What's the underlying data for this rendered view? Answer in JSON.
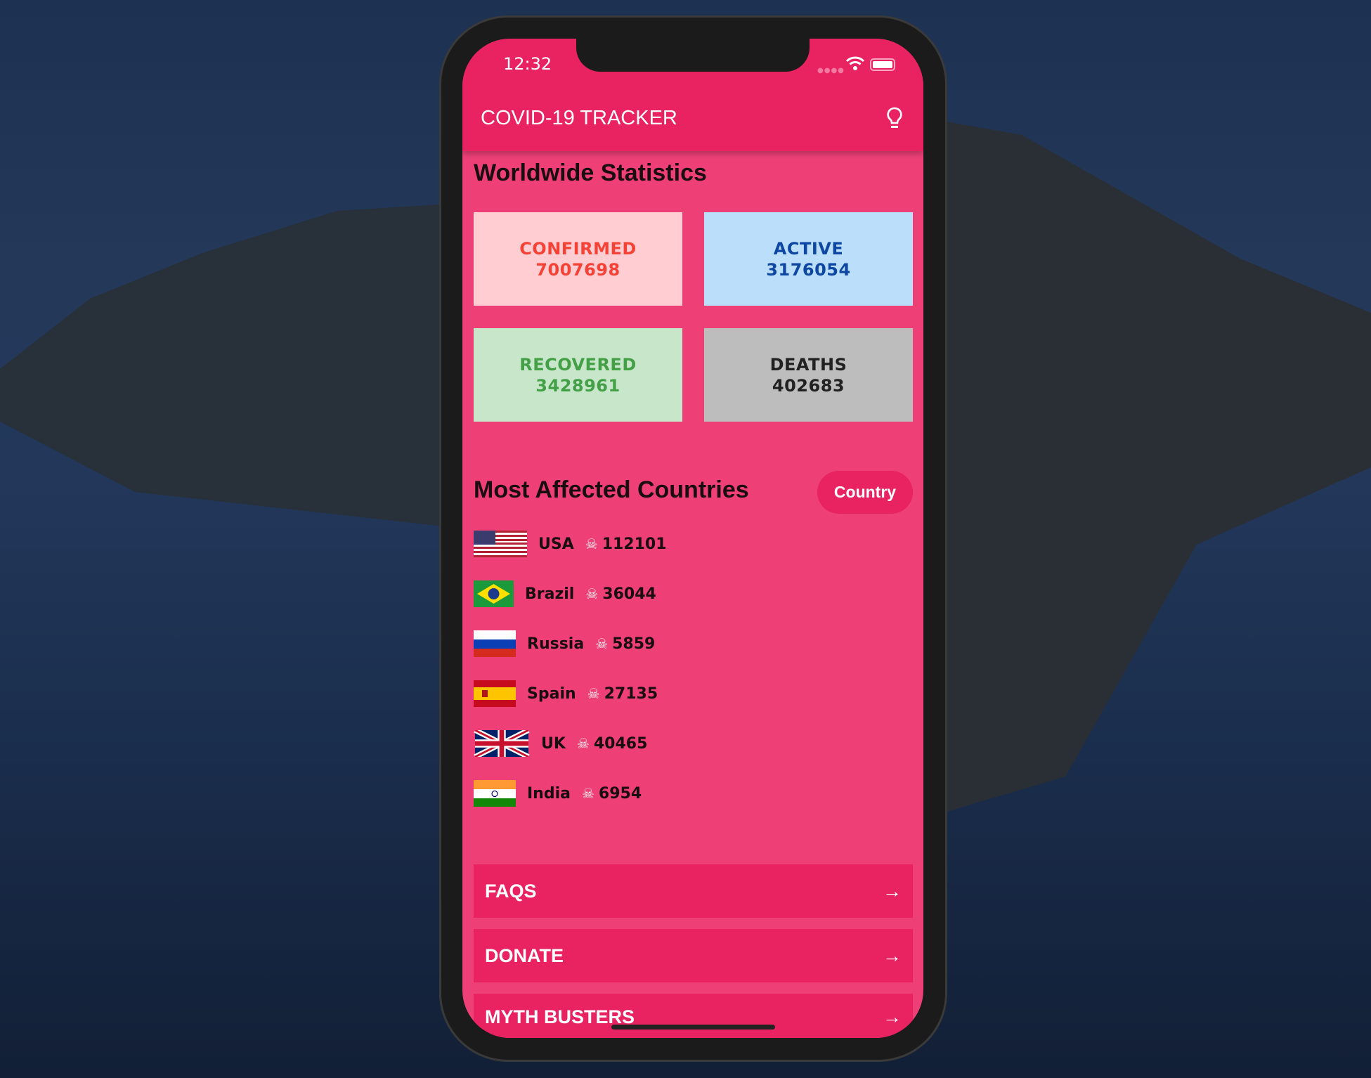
{
  "status_bar": {
    "time": "12:32"
  },
  "header": {
    "title": "COVID-19 TRACKER",
    "icon": "lightbulb-icon"
  },
  "worldwide": {
    "heading": "Worldwide Statistics",
    "cards": [
      {
        "label": "CONFIRMED",
        "value": "7007698",
        "bg": "#ffcdd2",
        "color": "#f44336"
      },
      {
        "label": "ACTIVE",
        "value": "3176054",
        "bg": "#bbdefb",
        "color": "#0d47a1"
      },
      {
        "label": "RECOVERED",
        "value": "3428961",
        "bg": "#c8e6c9",
        "color": "#43a047"
      },
      {
        "label": "DEATHS",
        "value": "402683",
        "bg": "#bdbdbd",
        "color": "#212121"
      }
    ]
  },
  "most_affected": {
    "heading": "Most Affected Countries",
    "country_button": "Country",
    "countries": [
      {
        "name": "USA",
        "deaths": "112101",
        "flag": "us"
      },
      {
        "name": "Brazil",
        "deaths": "36044",
        "flag": "br"
      },
      {
        "name": "Russia",
        "deaths": "5859",
        "flag": "ru"
      },
      {
        "name": "Spain",
        "deaths": "27135",
        "flag": "es"
      },
      {
        "name": "UK",
        "deaths": "40465",
        "flag": "gb"
      },
      {
        "name": "India",
        "deaths": "6954",
        "flag": "in"
      }
    ]
  },
  "nav": [
    {
      "label": "FAQS"
    },
    {
      "label": "DONATE"
    },
    {
      "label": "MYTH BUSTERS"
    }
  ],
  "colors": {
    "primary": "#e92262",
    "background": "#ee4077"
  }
}
